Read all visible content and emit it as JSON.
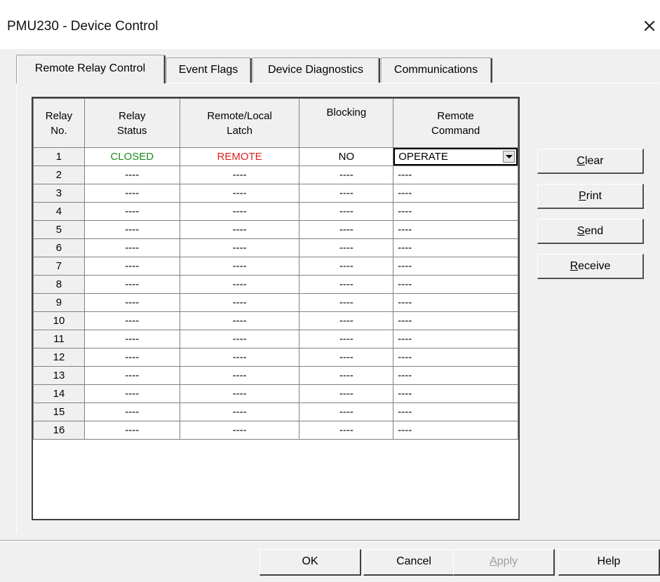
{
  "window": {
    "title": "PMU230 - Device Control",
    "close": "×"
  },
  "tabs": [
    {
      "label": "Remote Relay Control",
      "active": true
    },
    {
      "label": "Event Flags",
      "active": false
    },
    {
      "label": "Device Diagnostics",
      "active": false
    },
    {
      "label": "Communications",
      "active": false
    }
  ],
  "grid": {
    "headers": [
      {
        "line1": "Relay",
        "line2": "No."
      },
      {
        "line1": "Relay",
        "line2": "Status"
      },
      {
        "line1": "Remote/Local",
        "line2": "Latch"
      },
      {
        "line1": "Blocking",
        "line2": ""
      },
      {
        "line1": "Remote",
        "line2": "Command"
      }
    ],
    "rows": [
      [
        "1",
        "CLOSED",
        "REMOTE",
        "NO",
        "OPERATE"
      ],
      [
        "2",
        "----",
        "----",
        "----",
        "----"
      ],
      [
        "3",
        "----",
        "----",
        "----",
        "----"
      ],
      [
        "4",
        "----",
        "----",
        "----",
        "----"
      ],
      [
        "5",
        "----",
        "----",
        "----",
        "----"
      ],
      [
        "6",
        "----",
        "----",
        "----",
        "----"
      ],
      [
        "7",
        "----",
        "----",
        "----",
        "----"
      ],
      [
        "8",
        "----",
        "----",
        "----",
        "----"
      ],
      [
        "9",
        "----",
        "----",
        "----",
        "----"
      ],
      [
        "10",
        "----",
        "----",
        "----",
        "----"
      ],
      [
        "11",
        "----",
        "----",
        "----",
        "----"
      ],
      [
        "12",
        "----",
        "----",
        "----",
        "----"
      ],
      [
        "13",
        "----",
        "----",
        "----",
        "----"
      ],
      [
        "14",
        "----",
        "----",
        "----",
        "----"
      ],
      [
        "15",
        "----",
        "----",
        "----",
        "----"
      ],
      [
        "16",
        "----",
        "----",
        "----",
        "----"
      ]
    ],
    "colors": {
      "closed": "#1e8a1e",
      "remote": "#e02020"
    }
  },
  "side_buttons": [
    {
      "label": "Clear",
      "accel": "C",
      "rest": "lear",
      "name": "clear-button"
    },
    {
      "label": "Print",
      "accel": "P",
      "rest": "rint",
      "name": "print-button"
    },
    {
      "label": "Send",
      "accel": "S",
      "rest": "end",
      "name": "send-button"
    },
    {
      "label": "Receive",
      "accel": "R",
      "rest": "eceive",
      "name": "receive-button"
    }
  ],
  "footer": {
    "ok": "OK",
    "cancel": "Cancel",
    "apply_accel": "A",
    "apply_rest": "pply",
    "help": "Help"
  }
}
